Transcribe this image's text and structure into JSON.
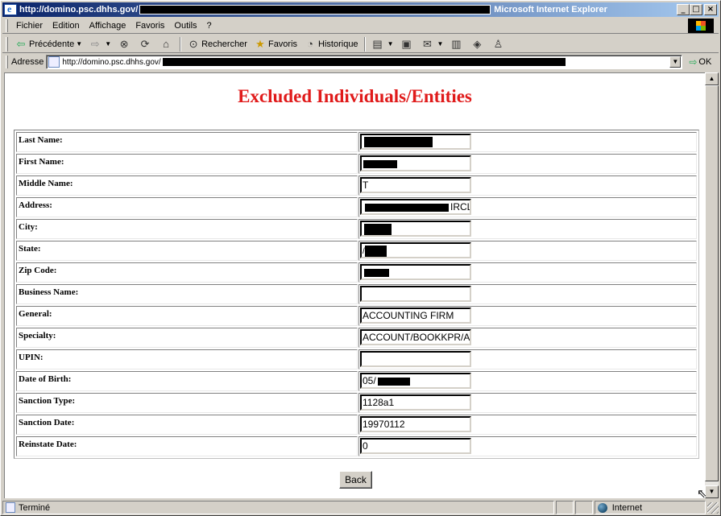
{
  "window": {
    "title_url": "http://domino.psc.dhhs.gov/",
    "app_name": "Microsoft Internet Explorer",
    "min": "_",
    "max": "□",
    "close": "×"
  },
  "menu": {
    "items": [
      "Fichier",
      "Edition",
      "Affichage",
      "Favoris",
      "Outils",
      "?"
    ]
  },
  "toolbar": {
    "back_label": "Précédente",
    "search_label": "Rechercher",
    "favorites_label": "Favoris",
    "history_label": "Historique"
  },
  "address": {
    "label": "Adresse",
    "url": "http://domino.psc.dhhs.gov/",
    "go_label": "OK"
  },
  "page": {
    "title": "Excluded Individuals/Entities",
    "fields": [
      {
        "label": "Last Name:",
        "value": ""
      },
      {
        "label": "First Name:",
        "value": ""
      },
      {
        "label": "Middle Name:",
        "value": "T"
      },
      {
        "label": "Address:",
        "value": "IRCL"
      },
      {
        "label": "City:",
        "value": ""
      },
      {
        "label": "State:",
        "value": "/"
      },
      {
        "label": "Zip Code:",
        "value": ""
      },
      {
        "label": "Business Name:",
        "value": ""
      },
      {
        "label": "General:",
        "value": "ACCOUNTING FIRM"
      },
      {
        "label": "Specialty:",
        "value": "ACCOUNT/BOOKKPR/A"
      },
      {
        "label": "UPIN:",
        "value": ""
      },
      {
        "label": "Date of Birth:",
        "value": "05/"
      },
      {
        "label": "Sanction Type:",
        "value": "1128a1"
      },
      {
        "label": "Sanction Date:",
        "value": "19970112"
      },
      {
        "label": "Reinstate Date:",
        "value": "0"
      }
    ],
    "back_button": "Back"
  },
  "status": {
    "text": "Terminé",
    "zone": "Internet"
  },
  "colors": {
    "title_red": "#e01a1a",
    "titlebar_start": "#0a246a",
    "titlebar_end": "#a6caf0",
    "chrome": "#d4d0c8"
  },
  "icons": [
    "ie-icon",
    "back-arrow-icon",
    "forward-arrow-icon",
    "stop-icon",
    "refresh-icon",
    "home-icon",
    "search-icon",
    "favorites-icon",
    "history-icon",
    "edit-icon",
    "print-icon",
    "mail-icon",
    "discuss-icon",
    "messenger-icon",
    "user-icon",
    "page-icon",
    "globe-icon"
  ]
}
